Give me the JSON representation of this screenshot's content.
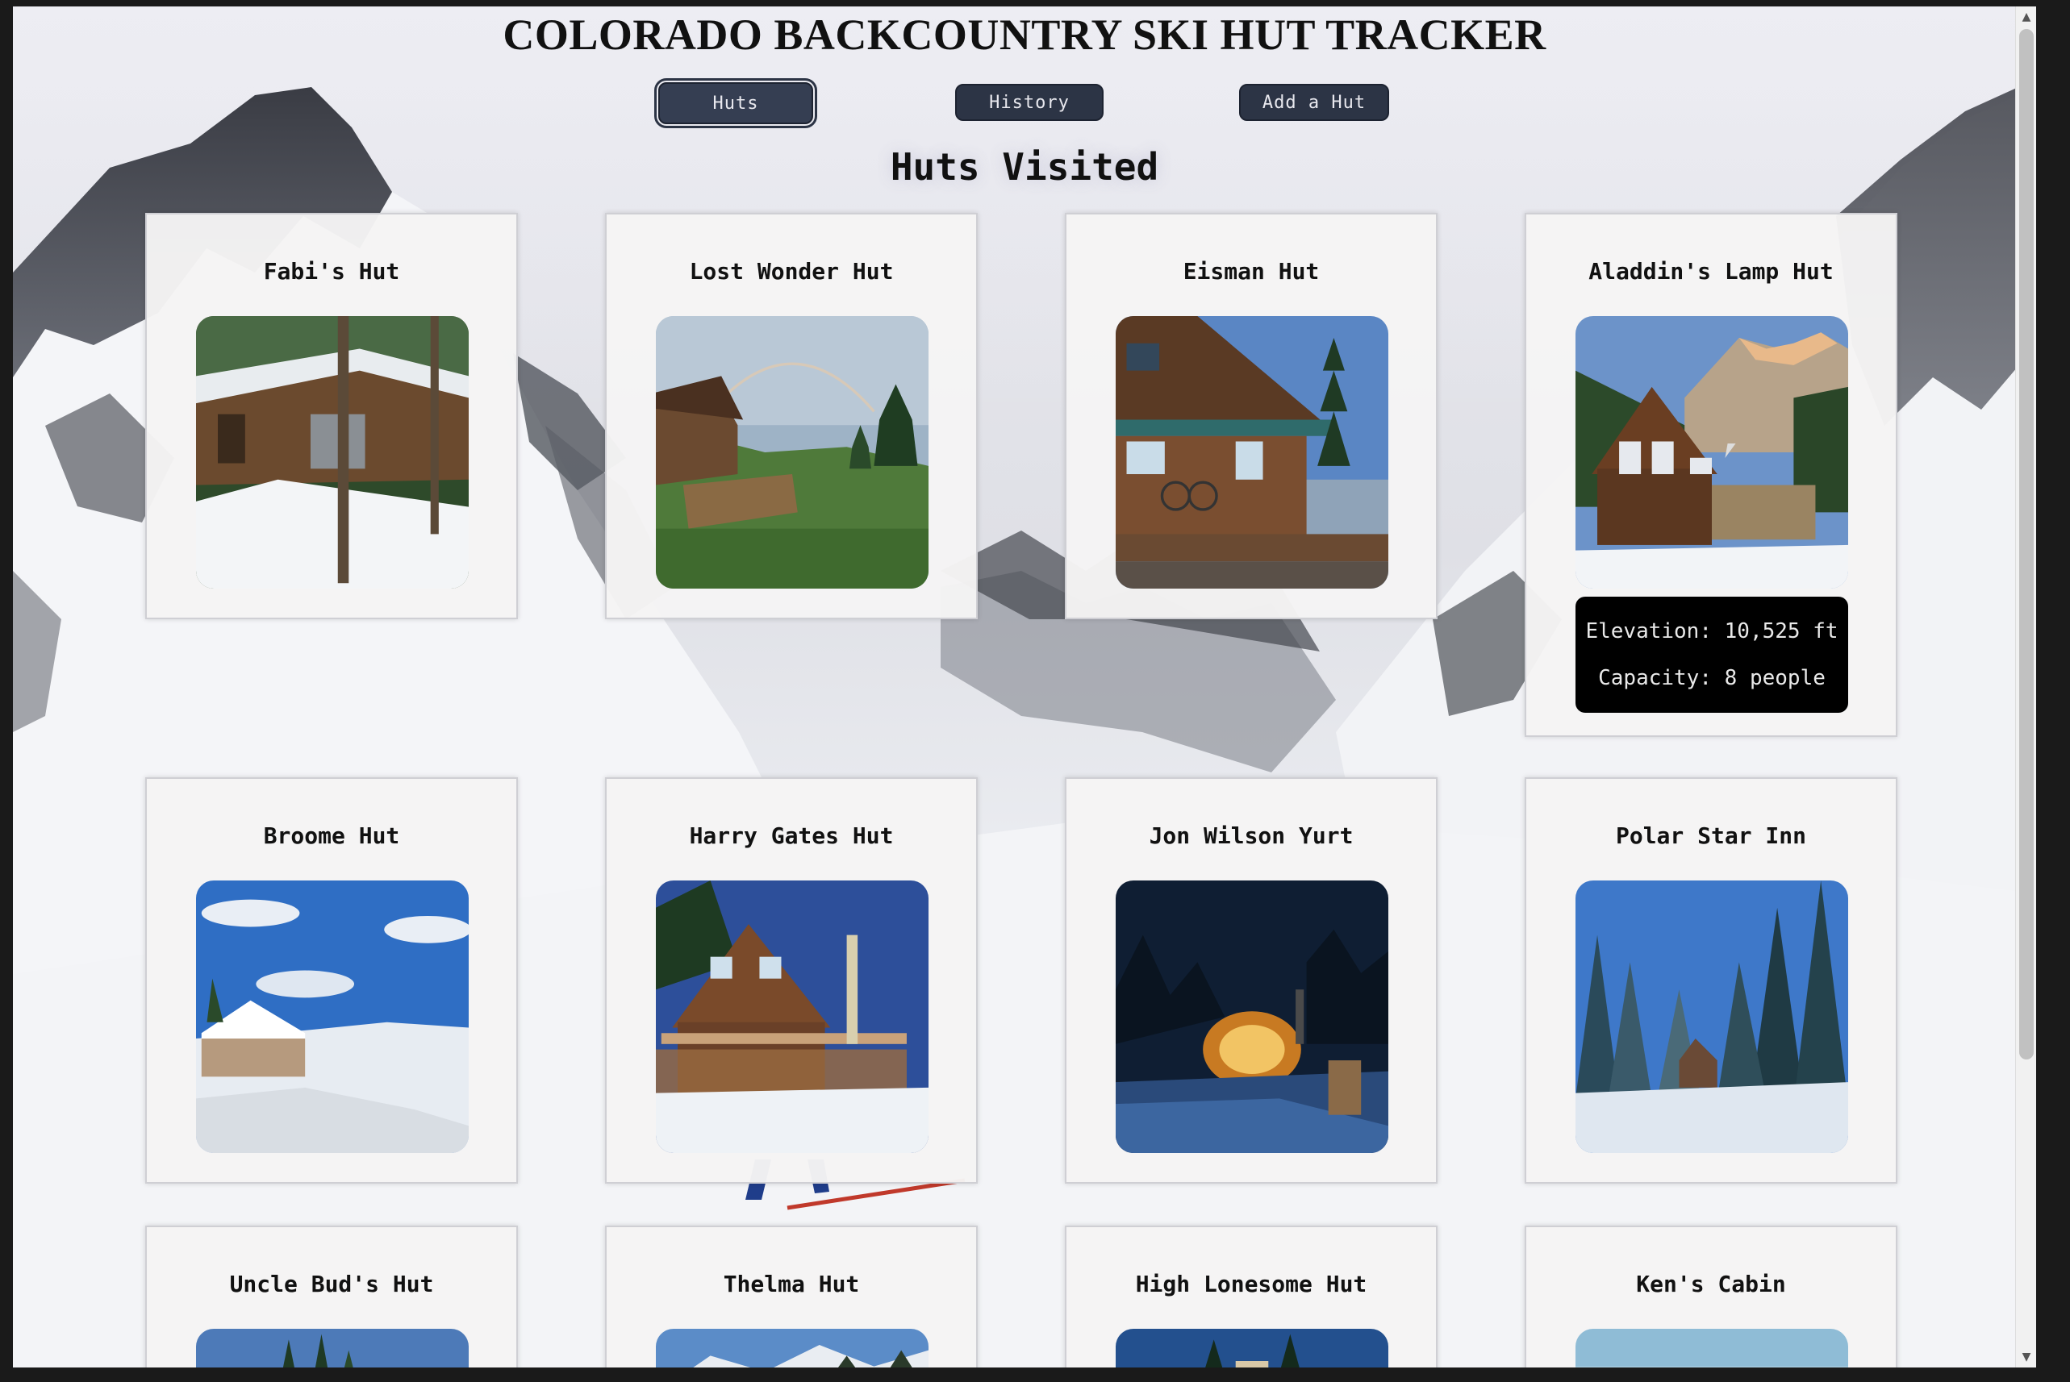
{
  "header": {
    "title": "COLORADO BACKCOUNTRY SKI HUT TRACKER"
  },
  "nav": {
    "huts": "Huts",
    "history": "History",
    "add": "Add a Hut",
    "active": "huts"
  },
  "main": {
    "heading": "Huts Visited"
  },
  "huts": [
    {
      "name": "Fabi's Hut"
    },
    {
      "name": "Lost Wonder Hut"
    },
    {
      "name": "Eisman Hut"
    },
    {
      "name": "Aladdin's Lamp Hut",
      "elevation": "Elevation: 10,525 ft",
      "capacity": "Capacity: 8 people"
    },
    {
      "name": "Broome Hut"
    },
    {
      "name": "Harry Gates Hut"
    },
    {
      "name": "Jon Wilson Yurt"
    },
    {
      "name": "Polar Star Inn"
    },
    {
      "name": "Uncle Bud's Hut"
    },
    {
      "name": "Thelma Hut"
    },
    {
      "name": "High Lonesome Hut"
    },
    {
      "name": "Ken's Cabin"
    }
  ],
  "scrollbar": {
    "up_arrow": "▲",
    "down_arrow": "▼"
  }
}
